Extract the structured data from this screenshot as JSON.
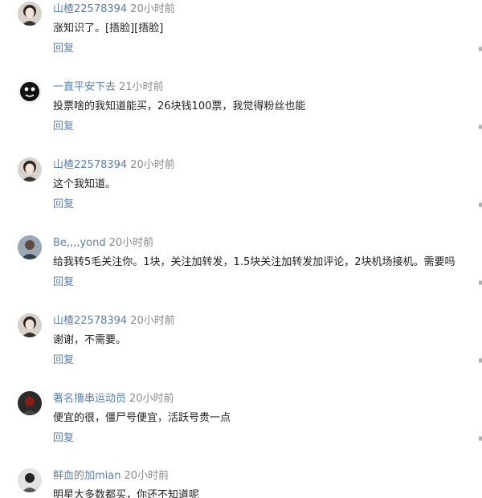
{
  "comments": [
    {
      "username": "山楂22578394",
      "time": "20小时前",
      "content": "涨知识了。[捂脸][捂脸]",
      "reply": "回复",
      "avatar": "girl-avatar"
    },
    {
      "username": "一直平安下去",
      "time": "21小时前",
      "content": "投票啥的我知道能买，26块钱100票，我觉得粉丝也能",
      "reply": "回复",
      "avatar": "cartoon-avatar"
    },
    {
      "username": "山楂22578394",
      "time": "20小时前",
      "content": "这个我知道。",
      "reply": "回复",
      "avatar": "girl-avatar"
    },
    {
      "username": "Be,,,,yond",
      "time": "20小时前",
      "content": "给我转5毛关注你。1块，关注加转发，1.5块关注加转发加评论，2块机场接机。需要吗",
      "reply": "回复",
      "avatar": "person-avatar"
    },
    {
      "username": "山楂22578394",
      "time": "20小时前",
      "content": "谢谢，不需要。",
      "reply": "回复",
      "avatar": "girl-avatar"
    },
    {
      "username": "著名撸串运动员",
      "time": "20小时前",
      "content": "便宜的很，僵尸号便宜，活跃号贵一点",
      "reply": "回复",
      "avatar": "dark-avatar"
    },
    {
      "username": "鲜血的加mian",
      "time": "20小时前",
      "content": "明星大多数都买，你还不知道呢",
      "reply": "",
      "avatar": "bw-avatar"
    }
  ],
  "colors": {
    "link": "#5a7fae",
    "time": "#8a8a8a",
    "text": "#1f1f1f"
  }
}
